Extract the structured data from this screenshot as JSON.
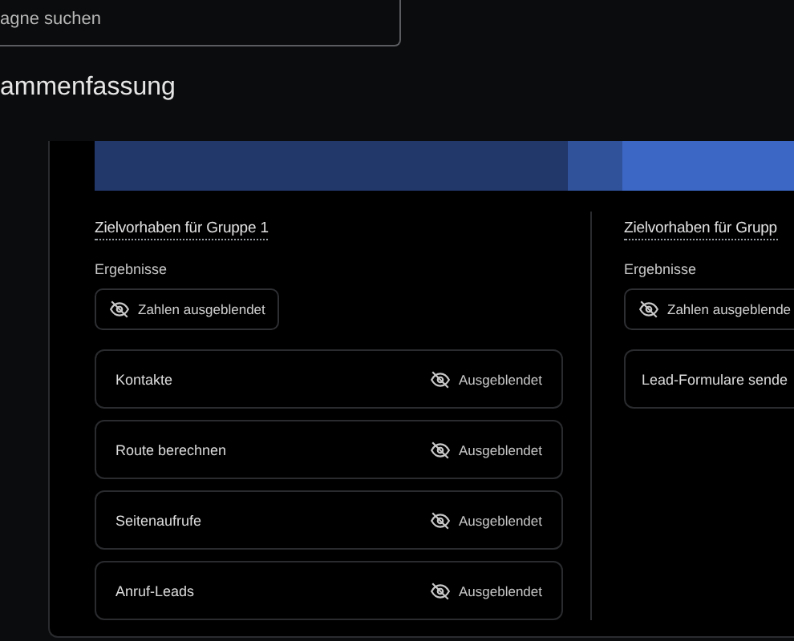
{
  "search": {
    "placeholder": "agne suchen"
  },
  "title": "ammenfassung",
  "bar_segments": [
    {
      "color": "#22376a"
    },
    {
      "color": "#30529a"
    },
    {
      "color": "#3c67c4"
    }
  ],
  "groups": [
    {
      "title": "Zielvorhaben für Gruppe 1",
      "results_label": "Ergebnisse",
      "toggle": "Zahlen ausgeblendet",
      "metrics": [
        {
          "name": "Kontakte",
          "status": "Ausgeblendet"
        },
        {
          "name": "Route berechnen",
          "status": "Ausgeblendet"
        },
        {
          "name": "Seitenaufrufe",
          "status": "Ausgeblendet"
        },
        {
          "name": "Anruf-Leads",
          "status": "Ausgeblendet"
        }
      ]
    },
    {
      "title": "Zielvorhaben für Grupp",
      "results_label": "Ergebnisse",
      "toggle": "Zahlen ausgeblende",
      "metrics": [
        {
          "name": "Lead-Formulare sende"
        }
      ]
    }
  ]
}
